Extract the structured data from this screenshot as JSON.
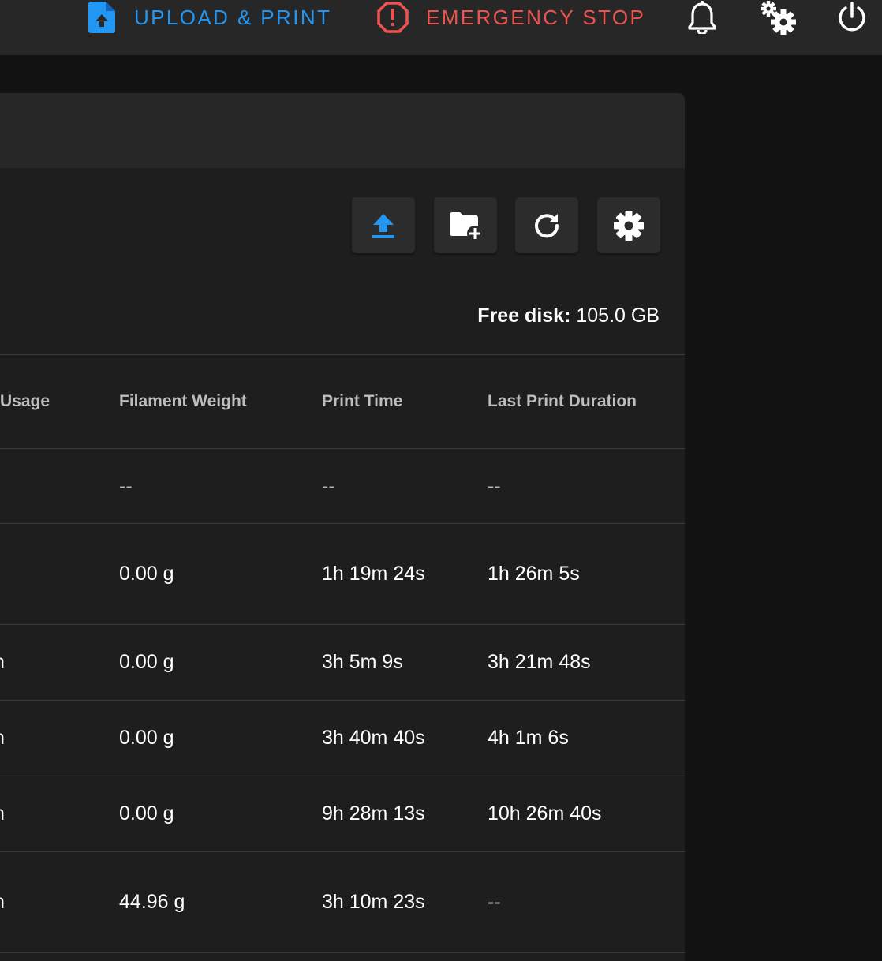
{
  "topbar": {
    "upload_print_label": "UPLOAD & PRINT",
    "emergency_stop_label": "EMERGENCY STOP",
    "accent_color": "#2196f3",
    "danger_color": "#ef5350"
  },
  "toolbar": {
    "icons": [
      "upload-icon",
      "folder-plus-icon",
      "refresh-icon",
      "gear-icon"
    ]
  },
  "disk": {
    "label": "Free disk:",
    "value": "105.0 GB"
  },
  "table": {
    "headers": {
      "usage": "Usage",
      "weight": "Filament Weight",
      "print_time": "Print Time",
      "last_duration": "Last Print Duration"
    },
    "rows": [
      {
        "usage": "",
        "weight": "--",
        "print_time": "--",
        "last_duration": "--"
      },
      {
        "usage": "",
        "weight": "0.00 g",
        "print_time": "1h 19m 24s",
        "last_duration": "1h 26m 5s"
      },
      {
        "usage": "n",
        "weight": "0.00 g",
        "print_time": "3h 5m 9s",
        "last_duration": "3h 21m 48s"
      },
      {
        "usage": "n",
        "weight": "0.00 g",
        "print_time": "3h 40m 40s",
        "last_duration": "4h 1m 6s"
      },
      {
        "usage": "n",
        "weight": "0.00 g",
        "print_time": "9h 28m 13s",
        "last_duration": "10h 26m 40s"
      },
      {
        "usage": "n",
        "weight": "44.96 g",
        "print_time": "3h 10m 23s",
        "last_duration": "--"
      }
    ]
  }
}
